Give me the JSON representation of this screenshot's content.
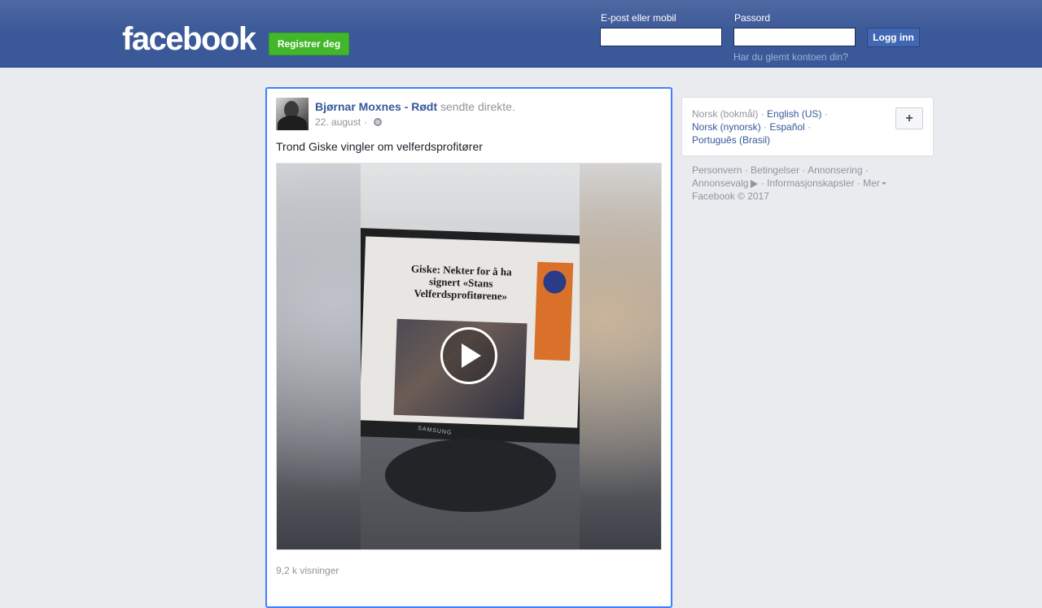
{
  "header": {
    "logo": "facebook",
    "register_label": "Registrer deg",
    "email_label": "E-post eller mobil",
    "email_value": "",
    "password_label": "Passord",
    "password_value": "",
    "login_label": "Logg inn",
    "forgot_label": "Har du glemt kontoen din?"
  },
  "post": {
    "author": "Bjørnar Moxnes - Rødt",
    "action": "sendte direkte.",
    "date": "22. august",
    "date_separator": "·",
    "privacy_icon": "globe-icon",
    "text": "Trond Giske vingler om velferdsprofitører",
    "video": {
      "screen_headline": "Giske: Nekter for å ha signert «Stans Velferdsprofitørene»",
      "monitor_brand": "SAMSUNG",
      "play_icon": "play-icon"
    },
    "views": "9,2 k visninger"
  },
  "languages": {
    "current": "Norsk (bokmål)",
    "items": [
      "English (US)",
      "Norsk (nynorsk)",
      "Español",
      "Português (Brasil)"
    ],
    "add_icon": "plus-icon",
    "add_label": "+"
  },
  "footer": {
    "links": [
      "Personvern",
      "Betingelser",
      "Annonsering",
      "Annonsevalg",
      "Informasjonskapsler",
      "Mer"
    ],
    "copyright": "Facebook © 2017"
  },
  "colors": {
    "brand_blue": "#3b5998",
    "register_green": "#42b72a",
    "link_blue": "#365899",
    "focus_border": "#4080ff"
  }
}
